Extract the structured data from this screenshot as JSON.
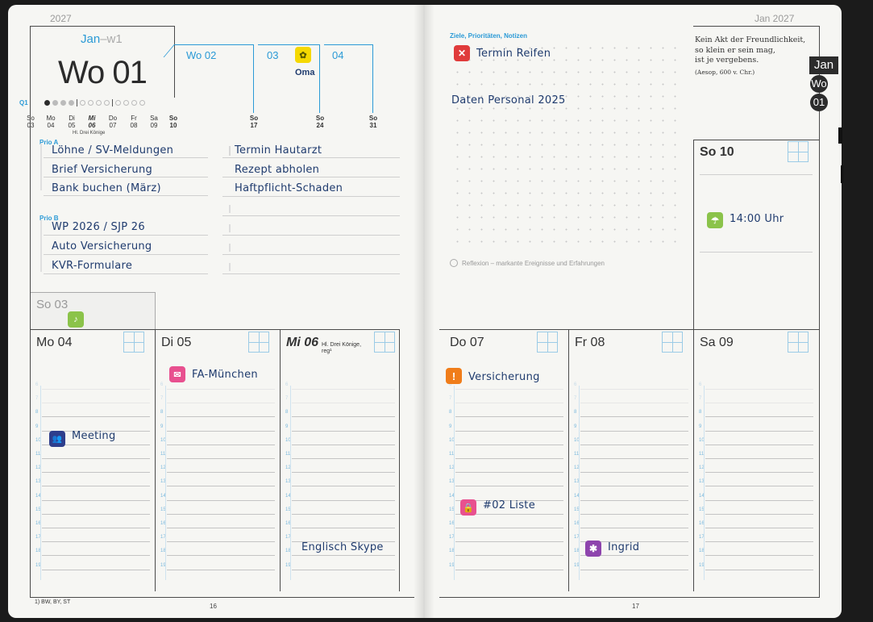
{
  "left_page": {
    "year": "2027",
    "month_week": "Jan",
    "month_week_sep": "–w1",
    "week_big": "Wo 01",
    "quarter": "Q1",
    "week_tabs": [
      "Wo 02",
      "03",
      "04"
    ],
    "oma_label": "Oma",
    "week_days": [
      {
        "d": "So",
        "n": "03"
      },
      {
        "d": "Mo",
        "n": "04"
      },
      {
        "d": "Di",
        "n": "05"
      },
      {
        "d": "Mi",
        "n": "06"
      },
      {
        "d": "Do",
        "n": "07"
      },
      {
        "d": "Fr",
        "n": "08"
      },
      {
        "d": "Sa",
        "n": "09"
      },
      {
        "d": "So",
        "n": "10"
      }
    ],
    "week_ends": [
      {
        "d": "So",
        "n": "17"
      },
      {
        "d": "So",
        "n": "24"
      },
      {
        "d": "So",
        "n": "31"
      }
    ],
    "holiday_note": "Hl. Drei Könige",
    "prio_a_label": "Prio A",
    "prio_a_left": [
      "Löhne / SV-Meldungen",
      "Brief Versicherung",
      "Bank buchen (März)"
    ],
    "prio_a_right": [
      "Termin Hautarzt",
      "Rezept abholen",
      "Haftpflicht-Schaden"
    ],
    "prio_b_label": "Prio B",
    "prio_b_left": [
      "WP 2026 / SJP 26",
      "Auto Versicherung",
      "KVR-Formulare"
    ],
    "sunday": "So 03",
    "days": [
      {
        "label": "Mo 04",
        "note": "",
        "entry": "Meeting"
      },
      {
        "label": "Di 05",
        "note": "",
        "entry": "FA-München"
      },
      {
        "label": "Mi 06",
        "note": "Hl. Drei Könige, reg¹",
        "entry": "Englisch Skype"
      }
    ],
    "footnote": "1) BW, BY, ST",
    "page_number": "16"
  },
  "right_page": {
    "year_label": "Jan 2027",
    "goals_label": "Ziele, Prioritäten, Notizen",
    "goal_1": "Termin Reifen",
    "goal_2": "Daten Personal 2025",
    "quote_lines": [
      "Kein Akt der Freundlichkeit,",
      "so klein er sein mag,",
      "ist je vergebens."
    ],
    "quote_author": "(Aesop, 600 v. Chr.)",
    "tab_month": "Jan",
    "tab_wo": "Wo",
    "tab_num": "01",
    "sunday": "So 10",
    "sunday_entry": "14:00 Uhr",
    "reflexion": "Reflexion – markante Ereignisse und Erfahrungen",
    "days": [
      {
        "label": "Do 07",
        "entry": "Versicherung",
        "entry2": "#02 Liste"
      },
      {
        "label": "Fr 08",
        "entry": "Ingrid"
      },
      {
        "label": "Sa 09",
        "entry": ""
      }
    ],
    "page_number": "17"
  },
  "hours": [
    "6",
    "7",
    "8",
    "9",
    "10",
    "11",
    "12",
    "13",
    "14",
    "15",
    "16",
    "17",
    "18",
    "19"
  ],
  "colors": {
    "accent_blue": "#2b9ad6",
    "ink": "#1f3b6e",
    "red": "#e03b3b",
    "pink": "#e8508f",
    "navy": "#2e3e8c",
    "orange": "#f07d1a",
    "yellow": "#f5d800",
    "green": "#8bc34a",
    "purple": "#8e44ad"
  }
}
